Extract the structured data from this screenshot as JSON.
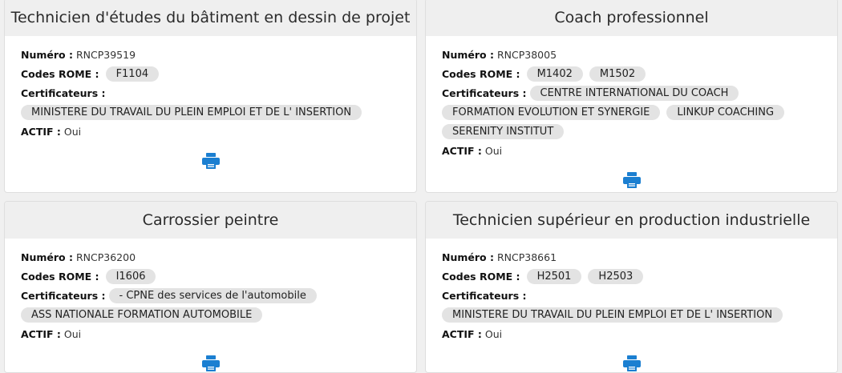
{
  "labels": {
    "numero": "Numéro :",
    "codes_rome": "Codes ROME :",
    "certificateurs": "Certificateurs :",
    "actif": "ACTIF :"
  },
  "icon_color": "#1b7fd1",
  "cards": [
    {
      "title": "Technicien d'études du bâtiment en dessin de projet",
      "numero": "RNCP39519",
      "rome": [
        "F1104"
      ],
      "certificateurs": [
        "MINISTERE DU TRAVAIL DU PLEIN EMPLOI ET DE L' INSERTION"
      ],
      "actif": "Oui",
      "print_icon": "printer-icon"
    },
    {
      "title": "Coach professionnel",
      "numero": "RNCP38005",
      "rome": [
        "M1402",
        "M1502"
      ],
      "certificateurs": [
        "CENTRE INTERNATIONAL DU COACH",
        "FORMATION EVOLUTION ET SYNERGIE",
        "LINKUP COACHING",
        "SERENITY INSTITUT"
      ],
      "actif": "Oui",
      "print_icon": "printer-icon"
    },
    {
      "title": "Carrossier peintre",
      "numero": "RNCP36200",
      "rome": [
        "I1606"
      ],
      "certificateurs": [
        "- CPNE des services de l'automobile",
        "ASS NATIONALE FORMATION AUTOMOBILE"
      ],
      "actif": "Oui",
      "print_icon": "printer-icon"
    },
    {
      "title": "Technicien supérieur en production industrielle",
      "numero": "RNCP38661",
      "rome": [
        "H2501",
        "H2503"
      ],
      "certificateurs": [
        "MINISTERE DU TRAVAIL DU PLEIN EMPLOI ET DE L' INSERTION"
      ],
      "actif": "Oui",
      "print_icon": "printer-icon"
    }
  ]
}
